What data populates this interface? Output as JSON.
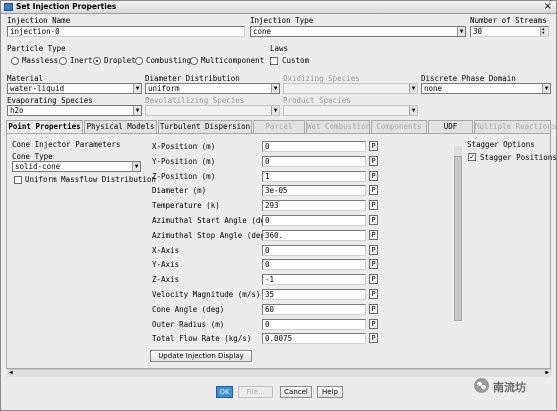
{
  "window": {
    "title": "Set Injection Properties",
    "close_glyph": "×"
  },
  "injection_name": {
    "label": "Injection Name",
    "value": "injection-0"
  },
  "injection_type": {
    "label": "Injection Type",
    "value": "cone"
  },
  "number_of_streams": {
    "label": "Number of Streams",
    "value": "30"
  },
  "particle_type": {
    "label": "Particle Type",
    "options": [
      "Massless",
      "Inert",
      "Droplet",
      "Combusting",
      "Multicomponent"
    ],
    "selected": "Droplet"
  },
  "laws": {
    "label": "Laws",
    "custom_label": "Custom"
  },
  "material": {
    "label": "Material",
    "value": "water-liquid"
  },
  "diameter_distribution": {
    "label": "Diameter Distribution",
    "value": "uniform"
  },
  "oxidizing_species": {
    "label": "Oxidizing Species",
    "value": ""
  },
  "discrete_phase_domain": {
    "label": "Discrete Phase Domain",
    "value": "none"
  },
  "evaporating_species": {
    "label": "Evaporating Species",
    "value": "h2o"
  },
  "devolatilizing_species": {
    "label": "Devolatilizing Species",
    "value": ""
  },
  "product_species": {
    "label": "Product Species",
    "value": ""
  },
  "tabs": [
    {
      "label": "Point Properties",
      "state": "active"
    },
    {
      "label": "Physical Models",
      "state": "enabled"
    },
    {
      "label": "Turbulent Dispersion",
      "state": "enabled"
    },
    {
      "label": "Parcel",
      "state": "disabled"
    },
    {
      "label": "Wet Combustion",
      "state": "disabled"
    },
    {
      "label": "Components",
      "state": "disabled"
    },
    {
      "label": "UDF",
      "state": "enabled"
    },
    {
      "label": "Multiple Reactions",
      "state": "disabled"
    }
  ],
  "cone_injector": {
    "heading": "Cone Injector Parameters",
    "cone_type_label": "Cone Type",
    "cone_type_value": "solid-cone",
    "uniform_massflow_label": "Uniform Massflow Distribution"
  },
  "parameters": [
    {
      "label": "X-Position (m)",
      "value": "0"
    },
    {
      "label": "Y-Position (m)",
      "value": "0"
    },
    {
      "label": "Z-Position (m)",
      "value": "1"
    },
    {
      "label": "Diameter (m)",
      "value": "3e-05"
    },
    {
      "label": "Temperature (k)",
      "value": "293"
    },
    {
      "label": "Azimuthal Start Angle (deg)",
      "value": "0"
    },
    {
      "label": "Azimuthal Stop Angle (deg)",
      "value": "360."
    },
    {
      "label": "X-Axis",
      "value": "0"
    },
    {
      "label": "Y-Axis",
      "value": "0"
    },
    {
      "label": "Z-Axis",
      "value": "-1"
    },
    {
      "label": "Velocity Magnitude (m/s)",
      "value": "35"
    },
    {
      "label": "Cone Angle (deg)",
      "value": "60"
    },
    {
      "label": "Outer Radius (m)",
      "value": "0"
    },
    {
      "label": "Total Flow Rate (kg/s)",
      "value": "0.0075"
    }
  ],
  "p_button_label": "P",
  "update_button": "Update Injection Display",
  "stagger": {
    "heading": "Stagger Options",
    "positions_label": "Stagger Positions",
    "positions_checked": true
  },
  "buttons": {
    "ok": "OK",
    "file": "File...",
    "cancel": "Cancel",
    "help": "Help"
  },
  "watermark": {
    "text": "南流坊"
  },
  "colors": {
    "ok_button": "#3c8fdb",
    "window_bg": "#ececec"
  }
}
